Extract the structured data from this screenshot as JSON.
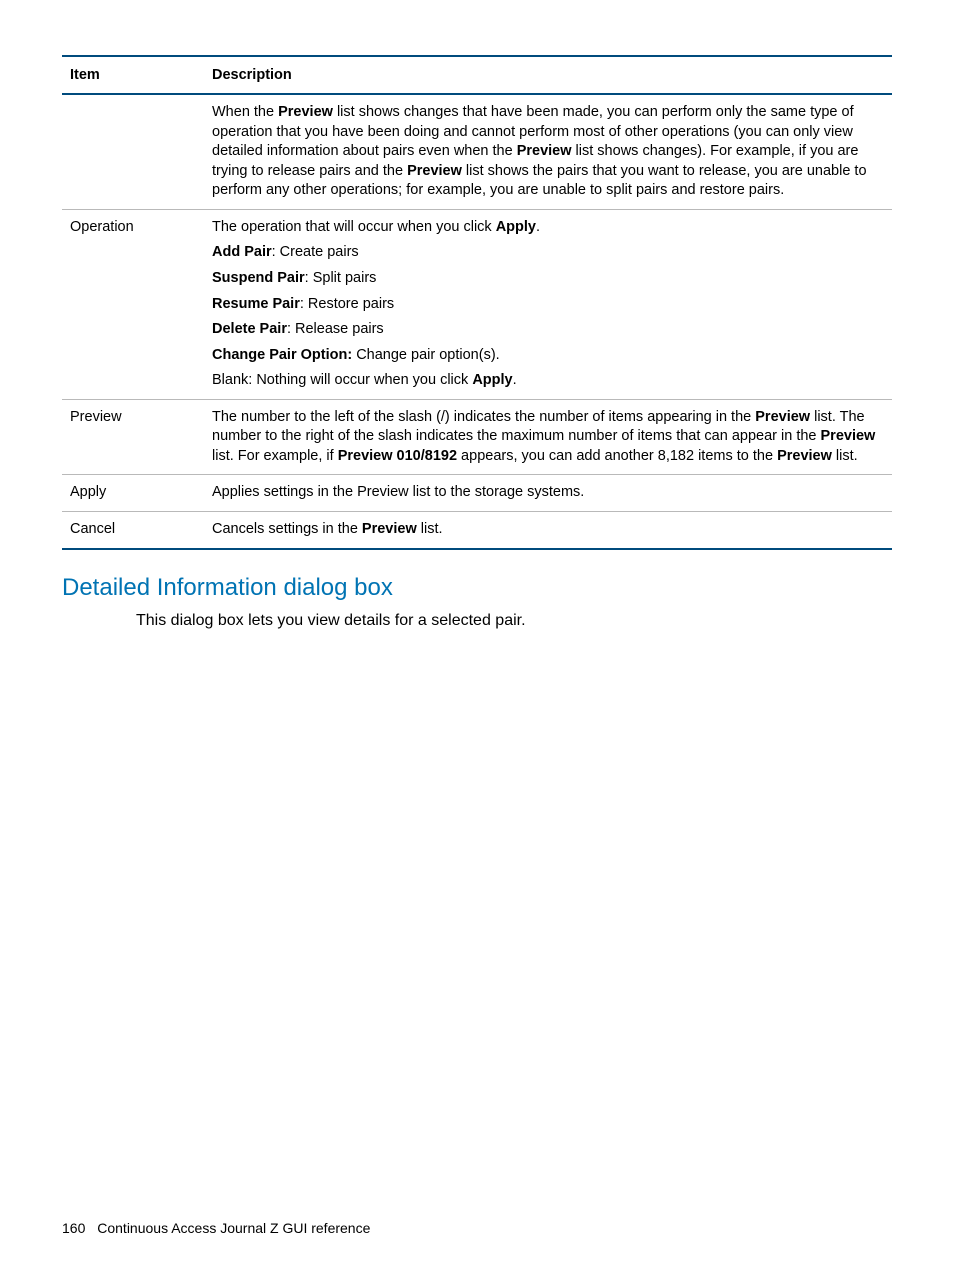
{
  "table": {
    "headers": {
      "item": "Item",
      "description": "Description"
    },
    "rows": [
      {
        "item": "",
        "desc": {
          "p1a": "When the ",
          "p1b": "Preview",
          "p1c": " list shows changes that have been made, you can perform only the same type of operation that you have been doing and cannot perform most of other operations (you can only view detailed information about pairs even when the ",
          "p1d": "Preview",
          "p1e": " list shows changes). For example, if you are trying to release pairs and the ",
          "p1f": "Preview",
          "p1g": " list shows the pairs that you want to release, you are unable to perform any other operations; for example, you are unable to split pairs and restore pairs."
        }
      },
      {
        "item": "Operation",
        "desc": {
          "intro_a": "The operation that will occur when you click ",
          "intro_b": "Apply",
          "intro_c": ".",
          "add_a": "Add Pair",
          "add_b": ": Create pairs",
          "suspend_a": "Suspend Pair",
          "suspend_b": ": Split pairs",
          "resume_a": "Resume Pair",
          "resume_b": ": Restore pairs",
          "delete_a": "Delete Pair",
          "delete_b": ": Release pairs",
          "change_a": "Change Pair Option:",
          "change_b": " Change pair option(s).",
          "blank_a": "Blank: Nothing will occur when you click ",
          "blank_b": "Apply",
          "blank_c": "."
        }
      },
      {
        "item": "Preview",
        "desc": {
          "p1a": "The number to the left of the slash (/) indicates the number of items appearing in the ",
          "p1b": "Preview",
          "p1c": " list. The number to the right of the slash indicates the maximum number of items that can appear in the ",
          "p1d": "Preview",
          "p1e": " list. For example, if ",
          "p1f": "Preview 010/8192",
          "p1g": " appears, you can add another 8,182 items to the ",
          "p1h": "Preview",
          "p1i": " list."
        }
      },
      {
        "item": "Apply",
        "desc": {
          "text": "Applies settings in the Preview list to the storage systems."
        }
      },
      {
        "item": "Cancel",
        "desc": {
          "p1a": "Cancels settings in the ",
          "p1b": "Preview",
          "p1c": " list."
        }
      }
    ]
  },
  "section": {
    "heading": "Detailed Information dialog box",
    "intro": "This dialog box lets you view details for a selected pair."
  },
  "footer": {
    "page": "160",
    "title": "Continuous Access Journal Z GUI reference"
  }
}
